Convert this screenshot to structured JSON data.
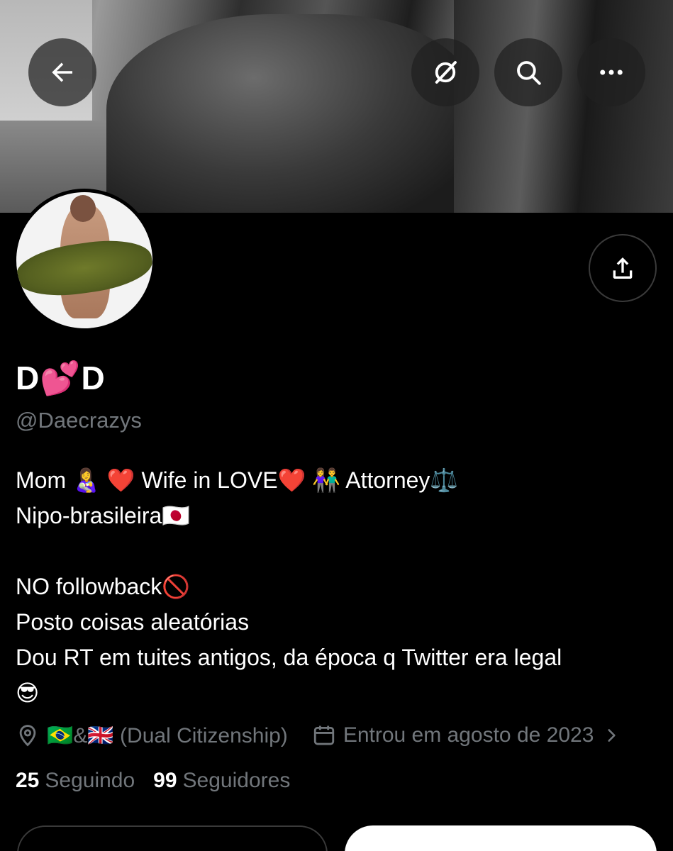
{
  "header": {
    "back_icon": "arrow-left-icon",
    "grok_icon": "grok-icon",
    "search_icon": "search-icon",
    "more_icon": "more-horizontal-icon"
  },
  "profile": {
    "display_name": "D💕D",
    "handle": "@Daecrazys",
    "share_icon": "share-upload-icon",
    "bio_lines": [
      "Mom 👩‍🍼 ❤️ Wife in LOVE❤️ 👫 Attorney⚖️",
      "Nipo-brasileira🇯🇵",
      "",
      "NO followback🚫",
      "Posto coisas aleatórias",
      "Dou RT em tuites antigos, da época q Twitter era legal",
      "😎"
    ],
    "location": "🇧🇷&🇬🇧 (Dual Citizenship)",
    "location_icon": "location-pin-icon",
    "joined": "Entrou em agosto de 2023",
    "joined_icon": "calendar-icon",
    "following_count": "25",
    "following_label": "Seguindo",
    "followers_count": "99",
    "followers_label": "Seguidores"
  },
  "colors": {
    "background": "#000000",
    "text": "#ffffff",
    "muted": "#71767b",
    "button_overlay": "#202020"
  }
}
